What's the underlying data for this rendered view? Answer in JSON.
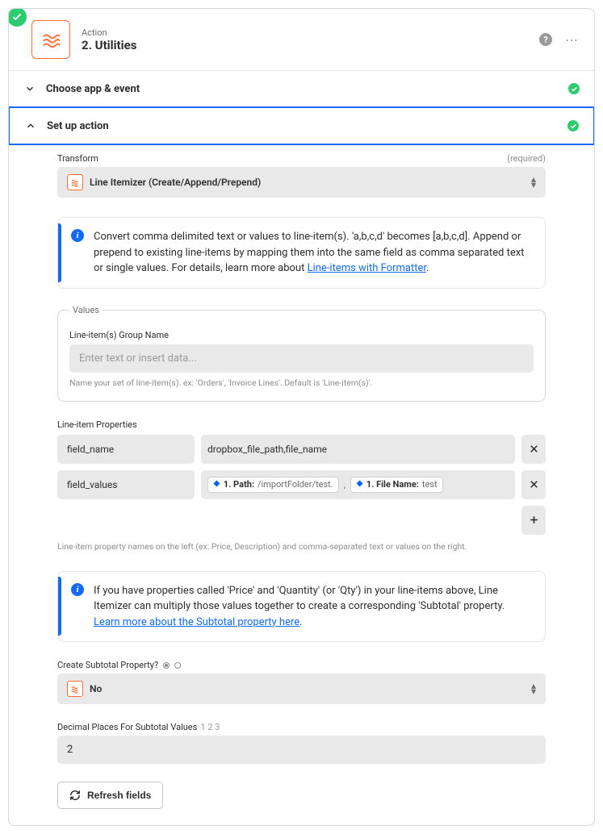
{
  "header": {
    "subtitle": "Action",
    "title": "2. Utilities"
  },
  "sections": {
    "choose": "Choose app & event",
    "setup": "Set up action"
  },
  "transform": {
    "label": "Transform",
    "required": "(required)",
    "value": "Line Itemizer (Create/Append/Prepend)"
  },
  "info1": {
    "text_before": "Convert comma delimited text or values to line-item(s). 'a,b,c,d' becomes [a,b,c,d]. Append or prepend to existing line-items by mapping them into the same field as comma separated text or single values. For details, learn more about ",
    "link_text": "Line-items with Formatter",
    "text_after": "."
  },
  "values_fieldset": {
    "legend": "Values",
    "group_label": "Line-item(s) Group Name",
    "group_placeholder": "Enter text or insert data...",
    "group_helper": "Name your set of line-item(s). ex: 'Orders', 'Invoice Lines'. Default is 'Line-item(s)'."
  },
  "props": {
    "label": "Line-item Properties",
    "rows": [
      {
        "key": "field_name",
        "value_plain": "dropbox_file_path,file_name"
      },
      {
        "key": "field_values",
        "pills": [
          {
            "prefix": "1. Path:",
            "path": "/importFolder/test."
          },
          {
            "prefix": "1. File Name:",
            "path": "test"
          }
        ]
      }
    ],
    "helper": "Line-item property names on the left (ex: Price, Description) and comma-separated text or values on the right."
  },
  "info2": {
    "text_before": "If you have properties called 'Price' and 'Quantity' (or 'Qty') in your line-items above, Line Itemizer can multiply those values together to create a corresponding 'Subtotal' property. ",
    "link_text": "Learn more about the Subtotal property here",
    "text_after": "."
  },
  "subtotal": {
    "label": "Create Subtotal Property?",
    "value": "No"
  },
  "decimal": {
    "label": "Decimal Places For Subtotal Values",
    "example": "1 2 3",
    "value": "2"
  },
  "refresh": "Refresh fields"
}
